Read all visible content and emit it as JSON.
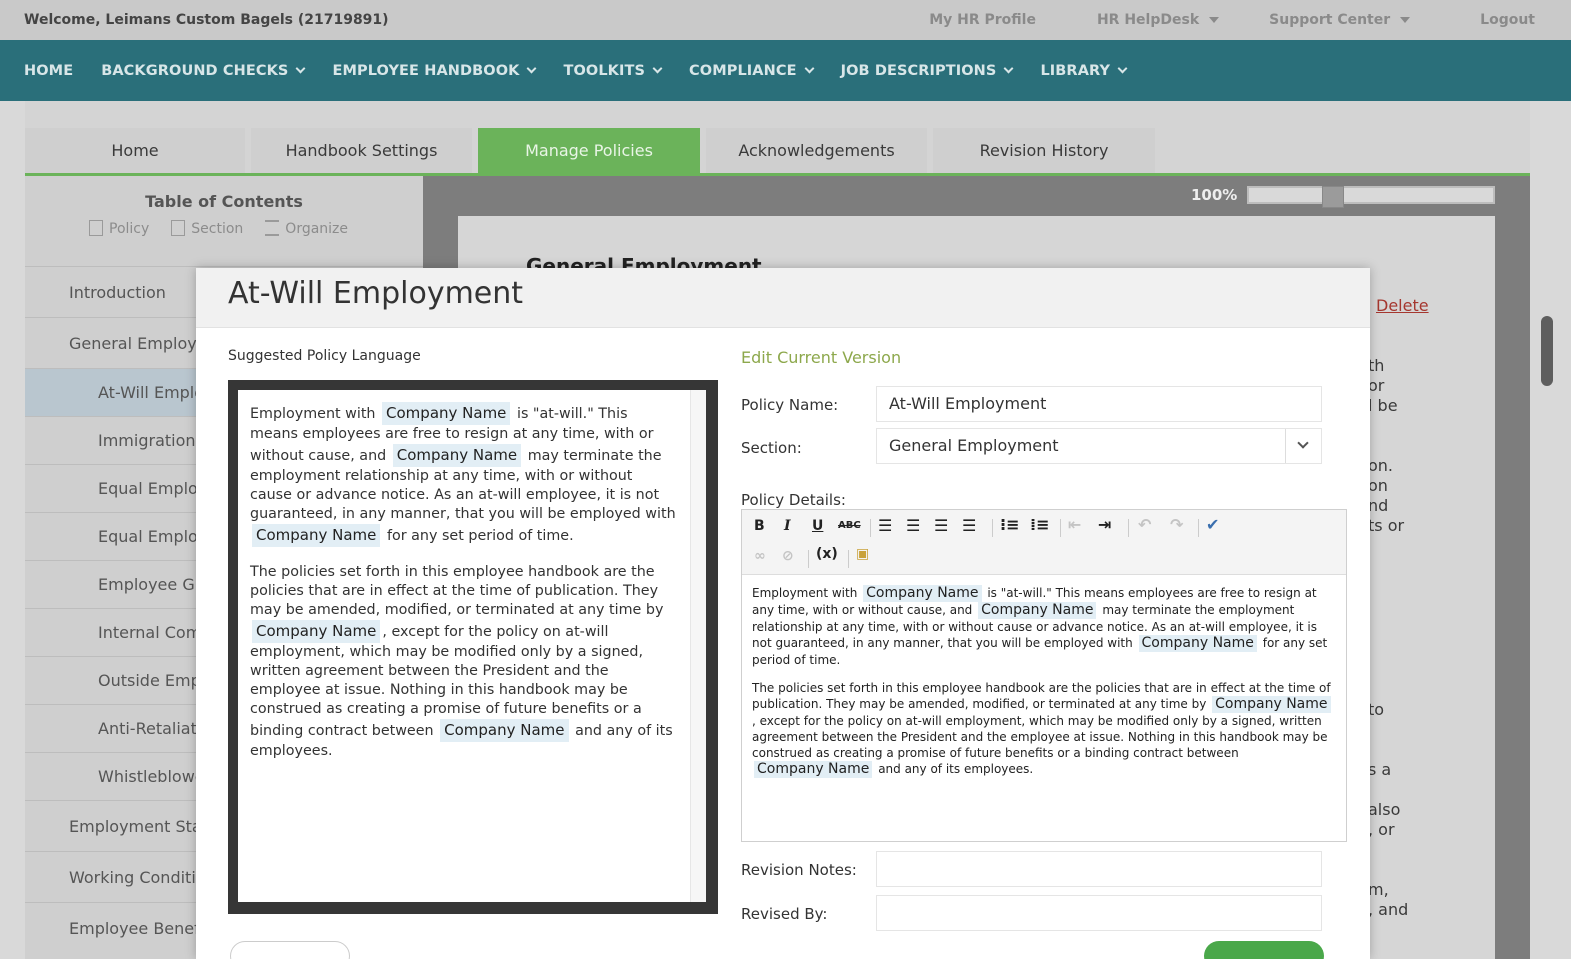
{
  "topbar": {
    "welcome": "Welcome, Leimans Custom Bagels (21719891)",
    "links": [
      "My HR Profile",
      "HR HelpDesk",
      "Support Center",
      "Logout"
    ]
  },
  "nav": [
    "HOME",
    "BACKGROUND CHECKS",
    "EMPLOYEE HANDBOOK",
    "TOOLKITS",
    "COMPLIANCE",
    "JOB DESCRIPTIONS",
    "LIBRARY"
  ],
  "tabs": [
    "Home",
    "Handbook Settings",
    "Manage Policies",
    "Acknowledgements",
    "Revision History"
  ],
  "toc": {
    "title": "Table of Contents",
    "tools": [
      "Policy",
      "Section",
      "Organize"
    ],
    "items": [
      "Introduction",
      "General Employr",
      "At-Will Emplo",
      "Immigration",
      "Equal Emplo",
      "Equal Emplo",
      "Employee Gr",
      "Internal Com",
      "Outside Emp",
      "Anti-Retaliati",
      "Whistleblowe",
      "Employment Sta",
      "Working Conditi",
      "Employee Benefi"
    ]
  },
  "viewer": {
    "zoom_label": "100%",
    "zoom_level": 0.33,
    "doc_title": "General Employment",
    "delete_label": "Delete",
    "fragments": [
      "th",
      "or",
      "l be",
      "on.",
      "on",
      "nd",
      "ts or",
      "to",
      "s a",
      "also",
      ", or",
      "m,",
      ", and"
    ]
  },
  "modal": {
    "title": "At-Will Employment",
    "suggested_label": "Suggested Policy Language",
    "merge_tag": "Company Name",
    "suggested_p1": [
      "Employment with ",
      "is \"at-will.\" This means employees are free to resign at any time, with or without cause, and ",
      "may terminate the employment relationship at any time, with or without cause or advance notice. As an at-will employee, it is not guaranteed, in any manner, that you will be employed with ",
      "for any set period of time."
    ],
    "suggested_p2": [
      "The policies set forth in this employee handbook are the policies that are in effect at the time of publication. They may be amended, modified, or terminated at any time by ",
      ", except for the policy on at-will employment, which may be modified only by a signed, written agreement between the President and the employee at issue. Nothing in this handbook may be construed as creating a promise of future benefits or a binding contract between ",
      "and any of its employees."
    ],
    "edit_title": "Edit Current Version",
    "policy_name_label": "Policy Name:",
    "policy_name_value": "At-Will Employment",
    "section_label": "Section:",
    "section_value": "General Employment",
    "policy_details_label": "Policy Details:",
    "revision_notes_label": "Revision Notes:",
    "revised_by_label": "Revised By:",
    "toolbar": [
      "B",
      "I",
      "U",
      "ABC"
    ]
  }
}
